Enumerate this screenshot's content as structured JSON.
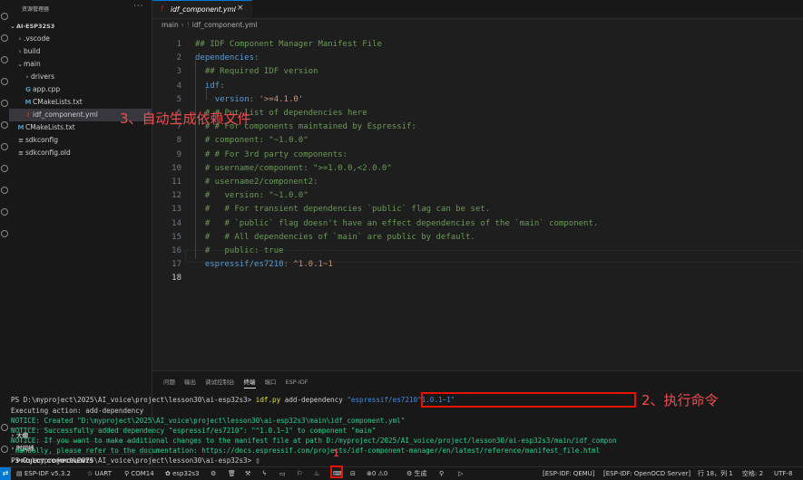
{
  "explorer": {
    "title": "资源管理器",
    "more": "···",
    "root": "AI-ESP32S3",
    "items": [
      {
        "label": ".vscode",
        "chev": "›",
        "icon": ""
      },
      {
        "label": "build",
        "chev": "›",
        "icon": ""
      },
      {
        "label": "main",
        "chev": "⌄",
        "icon": ""
      },
      {
        "label": "drivers",
        "chev": "›",
        "icon": ""
      },
      {
        "label": "app.cpp",
        "chev": "",
        "icon": "G"
      },
      {
        "label": "CMakeLists.txt",
        "chev": "",
        "icon": "M"
      },
      {
        "label": "idf_component.yml",
        "chev": "",
        "icon": "!"
      },
      {
        "label": "CMakeLists.txt",
        "chev": "",
        "icon": "M"
      },
      {
        "label": "sdkconfig",
        "chev": "",
        "icon": "≡"
      },
      {
        "label": "sdkconfig.old",
        "chev": "",
        "icon": "≡"
      }
    ],
    "bottom": [
      "大纲",
      "时间线",
      "PROJECT COMPONENTS"
    ]
  },
  "tab": {
    "label": "idf_component.yml",
    "icon": "!",
    "close": "×"
  },
  "breadcrumb": {
    "folder": "main",
    "sep": "›",
    "icon": "!",
    "file": "idf_component.yml"
  },
  "editor": {
    "lines": [
      {
        "n": "1",
        "t": "## IDF Component Manager Manifest File"
      },
      {
        "n": "2",
        "t": "dependencies:"
      },
      {
        "n": "3",
        "t": "  ## Required IDF version"
      },
      {
        "n": "4",
        "t": "  idf:"
      },
      {
        "n": "5",
        "t": "    version: '>=4.1.0'"
      },
      {
        "n": "6",
        "t": "  # # Put list of dependencies here"
      },
      {
        "n": "7",
        "t": "  # # For components maintained by Espressif:"
      },
      {
        "n": "8",
        "t": "  # component: \"~1.0.0\""
      },
      {
        "n": "9",
        "t": "  # # For 3rd party components:"
      },
      {
        "n": "10",
        "t": "  # username/component: \">=1.0.0,<2.0.0\""
      },
      {
        "n": "11",
        "t": "  # username2/component2:"
      },
      {
        "n": "12",
        "t": "  #   version: \"~1.0.0\""
      },
      {
        "n": "13",
        "t": "  #   # For transient dependencies `public` flag can be set."
      },
      {
        "n": "14",
        "t": "  #   # `public` flag doesn't have an effect dependencies of the `main` component."
      },
      {
        "n": "15",
        "t": "  #   # All dependencies of `main` are public by default."
      },
      {
        "n": "16",
        "t": "  #   public: true"
      },
      {
        "n": "17",
        "t": "  espressif/es7210: ^1.0.1~1"
      },
      {
        "n": "18",
        "t": ""
      }
    ]
  },
  "panel": {
    "tabs": [
      "问题",
      "输出",
      "调试控制台",
      "终端",
      "端口",
      "ESP-IDF"
    ],
    "active_tab": "终端",
    "prompt": "PS D:\\myproject\\2025\\AI_voice\\project\\lesson30\\ai-esp32s3> ",
    "cmd_name": "idf.py",
    "cmd_args": " add-dependency ",
    "cmd_value": "\"espressif/es7210^1.0.1~1\"",
    "executing": "Executing action: add-dependency",
    "notice1": "NOTICE: Created \"D:\\myproject\\2025\\AI_voice\\project\\lesson30\\ai-esp32s3\\main\\idf_component.yml\"",
    "notice2": "NOTICE: Successfully added dependency \"espressif/es7210\": \"^1.0.1~1\" to component \"main\"",
    "notice3": "NOTICE: If you want to make additional changes to the manifest file at path D:/myproject/2025/AI_voice/project/lesson30/ai-esp32s3/main/idf_compon",
    "notice4": " manually, please refer to the documentation: https://docs.espressif.com/projects/idf-component-manager/en/latest/reference/manifest_file.html",
    "final_prompt": "PS D:\\myproject\\2025\\AI_voice\\project\\lesson30\\ai-esp32s3> ▯"
  },
  "annotations": {
    "a1": "1",
    "a2": "2、执行命令",
    "a3": "3、自动生成依赖文件"
  },
  "statusbar": {
    "remote": "⇄",
    "idf_version": "ESP-IDF v5.3.2",
    "uart": "UART",
    "port": "COM14",
    "target": "esp32s3",
    "errors": "⊗0 ⚠0",
    "build": "生成",
    "qemu": "[ESP-IDF: QEMU]",
    "openocd": "[ESP-IDF: OpenOCD Server]",
    "position": "行 18，列 1",
    "spaces": "空格: 2",
    "encoding": "UTF-8"
  }
}
